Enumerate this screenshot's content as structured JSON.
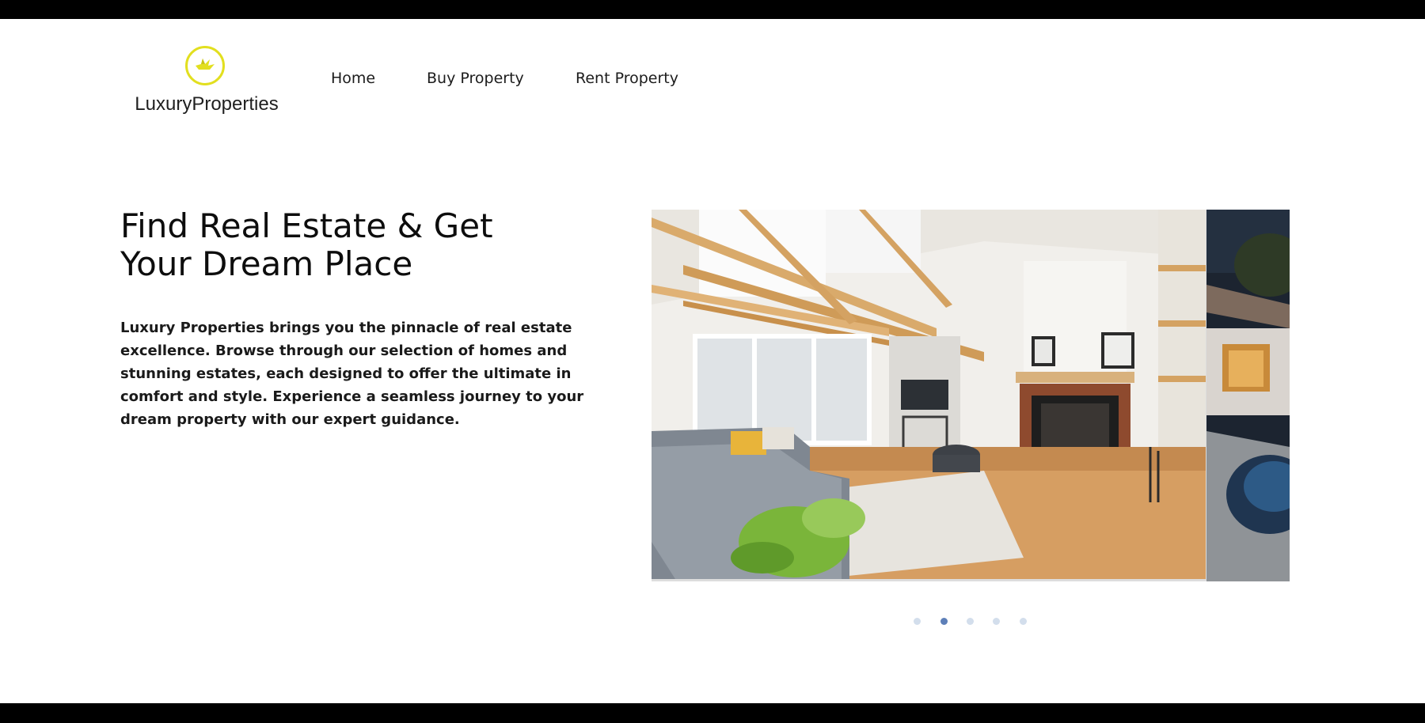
{
  "brand": {
    "name": "LuxuryProperties",
    "accent_color": "#e2df1f",
    "icon": "origami-crane-icon"
  },
  "nav": {
    "items": [
      {
        "label": "Home"
      },
      {
        "label": "Buy Property"
      },
      {
        "label": "Rent Property"
      }
    ]
  },
  "hero": {
    "title_line1": "Find Real Estate & Get",
    "title_line2": "Your Dream Place",
    "description": "Luxury Properties brings you the pinnacle of real estate excellence. Browse through our selection of homes and stunning estates, each designed to offer the ultimate in comfort and style. Experience a seamless journey to your dream property with our expert guidance."
  },
  "carousel": {
    "slides_count": 5,
    "active_index": 1,
    "dot_color": "#d3deec",
    "dot_active_color": "#5d7fb8"
  }
}
